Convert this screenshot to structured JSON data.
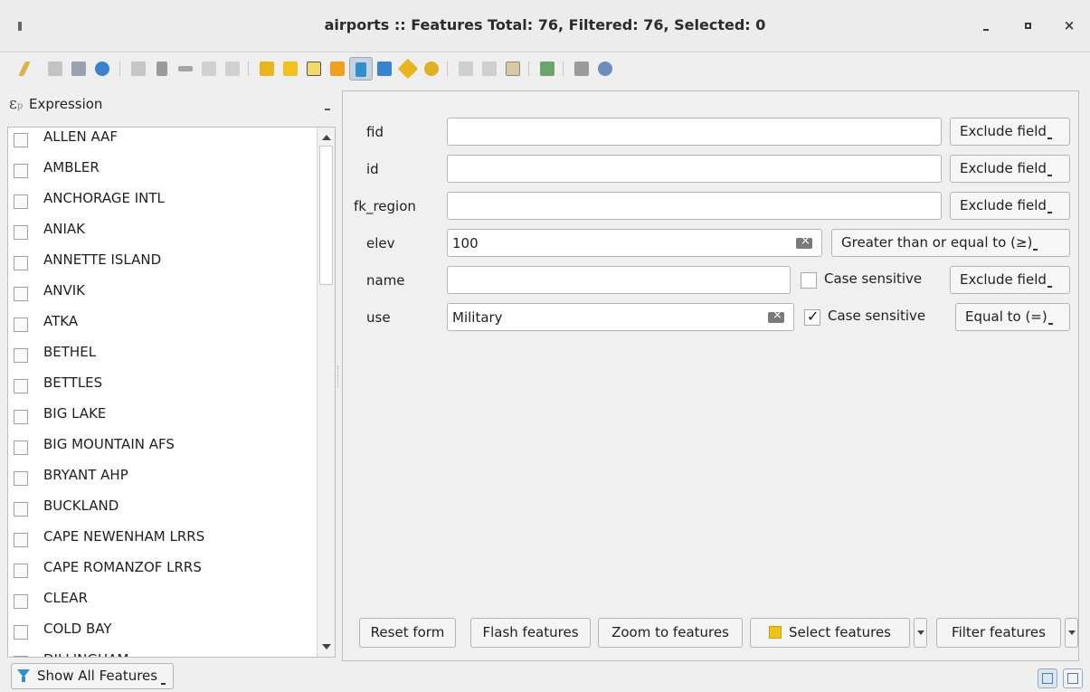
{
  "window": {
    "title": "airports :: Features Total: 76, Filtered: 76, Selected: 0"
  },
  "toolbar": {
    "buttons": [
      {
        "icon": "pencil-icon",
        "color": "#d9b44a"
      },
      {
        "icon": "multi-edit-icon",
        "color": "#b9b9b9"
      },
      {
        "icon": "save-icon",
        "color": "#9aa3ad"
      },
      {
        "icon": "reload-icon",
        "color": "#3a84cf"
      },
      {
        "icon": "add-feature-icon",
        "color": "#bcbcbc"
      },
      {
        "icon": "delete-icon",
        "color": "#8c8c8c"
      },
      {
        "icon": "cut-icon",
        "color": "#8c8c8c"
      },
      {
        "icon": "copy-icon",
        "color": "#bdbdbd"
      },
      {
        "icon": "paste-icon",
        "color": "#bdbdbd"
      },
      {
        "icon": "select-by-expression-icon",
        "color": "#e8b61c"
      },
      {
        "icon": "select-all-icon",
        "color": "#f0c21b"
      },
      {
        "icon": "invert-selection-icon",
        "color": "#f0c21b"
      },
      {
        "icon": "deselect-icon",
        "color": "#f0a020"
      },
      {
        "icon": "filter-icon",
        "color": "#2f8fcf"
      },
      {
        "icon": "move-selection-top-icon",
        "color": "#3a84cf"
      },
      {
        "icon": "pan-to-selection-icon",
        "color": "#e8b61c"
      },
      {
        "icon": "zoom-to-selection-icon",
        "color": "#e0b020"
      },
      {
        "icon": "copy-selected-rows-icon",
        "color": "#bdbdbd"
      },
      {
        "icon": "paste-features-icon",
        "color": "#bdbdbd"
      },
      {
        "icon": "new-field-icon",
        "color": "#c9a04a"
      },
      {
        "icon": "delete-field-icon",
        "color": "#6aa56a"
      },
      {
        "icon": "field-calculator-icon",
        "color": "#8c8c8c"
      },
      {
        "icon": "conditional-formatting-icon",
        "color": "#8c8c8c"
      },
      {
        "icon": "actions-icon",
        "color": "#6b8fb8"
      }
    ]
  },
  "expression": {
    "label": "Expression",
    "icon_symbol": "ε",
    "icon_sub": "p"
  },
  "features_list": [
    "ALLEN AAF",
    "AMBLER",
    "ANCHORAGE INTL",
    "ANIAK",
    "ANNETTE ISLAND",
    "ANVIK",
    "ATKA",
    "BETHEL",
    "BETTLES",
    "BIG LAKE",
    "BIG MOUNTAIN AFS",
    "BRYANT AHP",
    "BUCKLAND",
    "CAPE NEWENHAM LRRS",
    "CAPE ROMANZOF LRRS",
    "CLEAR",
    "COLD BAY",
    "DILLINGHAM"
  ],
  "form": {
    "fields": [
      {
        "label": "fid",
        "value": "",
        "operator": "Exclude field"
      },
      {
        "label": "id",
        "value": "",
        "operator": "Exclude field"
      },
      {
        "label": "fk_region",
        "value": "",
        "operator": "Exclude field"
      },
      {
        "label": "elev",
        "value": "100",
        "operator": "Greater than or equal to (≥)"
      },
      {
        "label": "name",
        "value": "",
        "case_sensitive": false,
        "case_label": "Case sensitive",
        "operator": "Exclude field"
      },
      {
        "label": "use",
        "value": "Military",
        "case_sensitive": true,
        "case_label": "Case sensitive",
        "operator": "Equal to (=)"
      }
    ]
  },
  "actions": {
    "reset_form": "Reset form",
    "flash_features": "Flash features",
    "zoom_to_features": "Zoom to features",
    "select_features": "Select features",
    "filter_features": "Filter features"
  },
  "statusbar": {
    "show_all": "Show All Features"
  }
}
